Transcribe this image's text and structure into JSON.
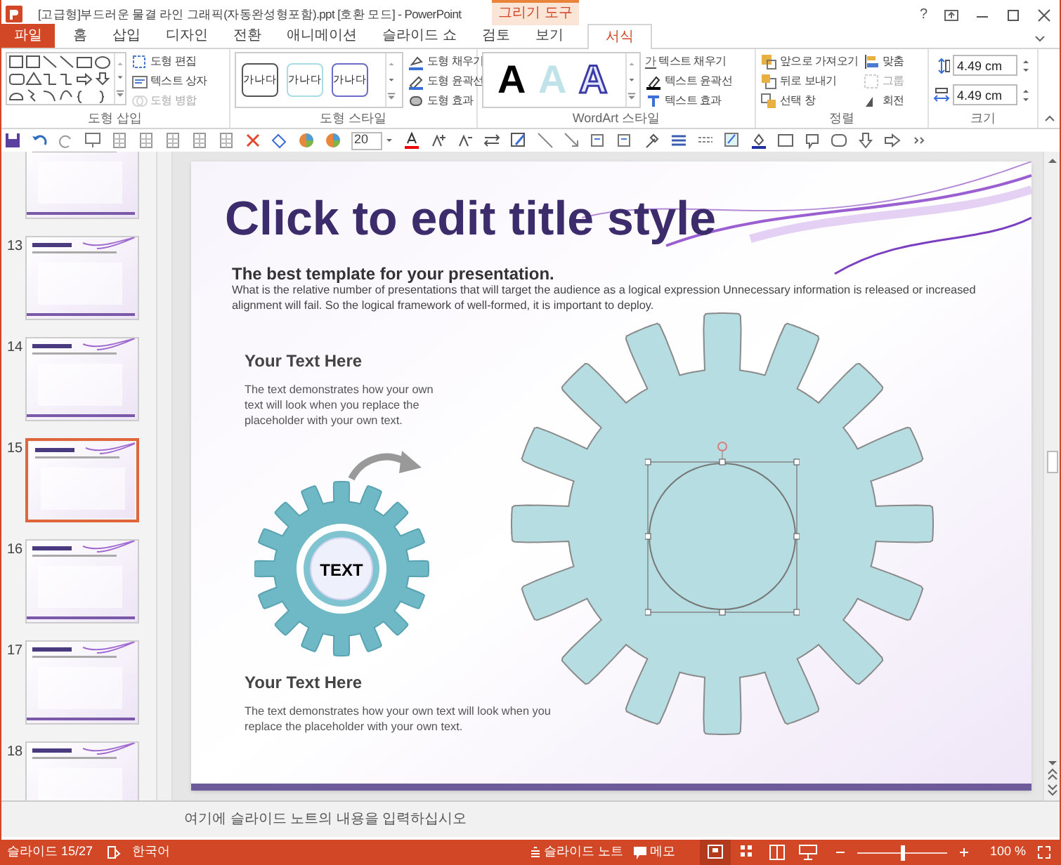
{
  "window": {
    "title": "[고급형]부드러운 물결 라인 그래픽(자동완성형포함).ppt [호환 모드] - PowerPoint",
    "context_tab": "그리기 도구",
    "help": "?"
  },
  "tabs": [
    {
      "label": "파일",
      "kind": "file",
      "selected": false
    },
    {
      "label": "홈",
      "kind": "tab",
      "selected": false
    },
    {
      "label": "삽입",
      "kind": "tab",
      "selected": false
    },
    {
      "label": "디자인",
      "kind": "tab",
      "selected": false
    },
    {
      "label": "전환",
      "kind": "tab",
      "selected": false
    },
    {
      "label": "애니메이션",
      "kind": "tab",
      "selected": false
    },
    {
      "label": "슬라이드 쇼",
      "kind": "tab",
      "selected": false
    },
    {
      "label": "검토",
      "kind": "tab",
      "selected": false
    },
    {
      "label": "보기",
      "kind": "tab",
      "selected": false
    },
    {
      "label": "서식",
      "kind": "context",
      "selected": true
    }
  ],
  "ribbon": {
    "shape_insert": {
      "label": "도형 삽입",
      "commands": [
        {
          "label": "도형 편집",
          "disabled": false
        },
        {
          "label": "텍스트 상자",
          "disabled": false
        },
        {
          "label": "도형 병합",
          "disabled": true
        }
      ]
    },
    "shape_styles": {
      "label": "도형 스타일",
      "presets": [
        {
          "text": "가나다",
          "color": "#555555"
        },
        {
          "text": "가나다",
          "color": "#a8dde3"
        },
        {
          "text": "가나다",
          "color": "#6b6bc8"
        }
      ],
      "commands": [
        {
          "label": "도형 채우기"
        },
        {
          "label": "도형 윤곽선"
        },
        {
          "label": "도형 효과"
        }
      ]
    },
    "wordart": {
      "label": "WordArt 스타일",
      "presets": [
        {
          "text": "A",
          "kind": "solid"
        },
        {
          "text": "A",
          "kind": "pale"
        },
        {
          "text": "A",
          "kind": "outline"
        }
      ],
      "commands": [
        {
          "label": "텍스트 채우기",
          "icon": "가"
        },
        {
          "label": "텍스트 윤곽선"
        },
        {
          "label": "텍스트 효과"
        }
      ]
    },
    "arrange": {
      "label": "정렬",
      "commands": [
        {
          "label": "앞으로 가져오기",
          "disabled": false
        },
        {
          "label": "뒤로 보내기",
          "disabled": false
        },
        {
          "label": "선택 창",
          "disabled": false
        },
        {
          "label": "맞춤",
          "disabled": false
        },
        {
          "label": "그룹",
          "disabled": true
        },
        {
          "label": "회전",
          "disabled": false
        }
      ]
    },
    "size": {
      "label": "크기",
      "height": "4.49 cm",
      "width": "4.49 cm"
    }
  },
  "quick_toolbar": {
    "font_size": "20"
  },
  "slides": [
    {
      "selected": false
    },
    {
      "number": "13",
      "selected": false
    },
    {
      "number": "14",
      "selected": false
    },
    {
      "number": "15",
      "selected": true
    },
    {
      "number": "16",
      "selected": false
    },
    {
      "number": "17",
      "selected": false
    },
    {
      "number": "18",
      "selected": false
    }
  ],
  "slide": {
    "title": "Click to edit title style",
    "subtitle": "The best template for your presentation.",
    "intro": "What is the relative number of presentations that will target the audience as a logical expression Unnecessary information is released or increased alignment will fail. So the logical framework of well-formed, it is important to deploy.",
    "blocks": [
      {
        "heading": "Your Text Here",
        "text": "The text demonstrates how your own text will look when you replace the placeholder with your own text."
      },
      {
        "heading": "Your Text Here",
        "text": "The text demonstrates how your own text will look when you replace the placeholder with your own text."
      }
    ],
    "gear_label": "TEXT"
  },
  "notes": {
    "placeholder": "여기에 슬라이드 노트의 내용을 입력하십시오"
  },
  "status_bar": {
    "slide": "슬라이드 15/27",
    "language": "한국어",
    "notes": "슬라이드 노트",
    "comments": "메모",
    "zoom": "100 %",
    "zoom_level": {
      "level": 0.5
    }
  }
}
